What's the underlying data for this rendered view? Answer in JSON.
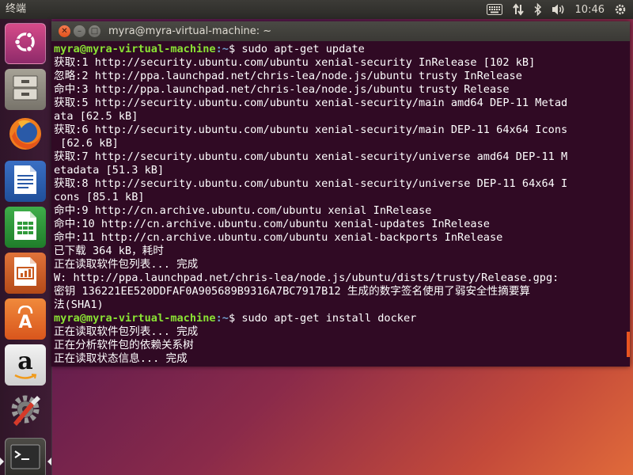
{
  "top_panel": {
    "app_title": "终端",
    "clock": "10:46"
  },
  "launcher": {
    "items": [
      {
        "name": "Dash",
        "icon": "ubuntu-dash-icon"
      },
      {
        "name": "Files",
        "icon": "files-icon"
      },
      {
        "name": "Firefox",
        "icon": "firefox-icon"
      },
      {
        "name": "LibreOffice Writer",
        "icon": "writer-icon"
      },
      {
        "name": "LibreOffice Calc",
        "icon": "calc-icon"
      },
      {
        "name": "LibreOffice Impress",
        "icon": "impress-icon"
      },
      {
        "name": "Ubuntu Software",
        "icon": "software-center-icon"
      },
      {
        "name": "Amazon",
        "icon": "amazon-icon"
      },
      {
        "name": "System Settings",
        "icon": "settings-icon"
      },
      {
        "name": "Terminal",
        "icon": "terminal-icon"
      }
    ],
    "amazon_letter": "a",
    "software_letter": "A"
  },
  "terminal": {
    "title": "myra@myra-virtual-machine: ~",
    "prompt_user": "myra@myra-virtual-machine",
    "prompt_path": ":~",
    "lines": [
      {
        "type": "prompt",
        "cmd": "$ sudo apt-get update"
      },
      {
        "type": "text",
        "text": "获取:1 http://security.ubuntu.com/ubuntu xenial-security InRelease [102 kB]"
      },
      {
        "type": "text",
        "text": "忽略:2 http://ppa.launchpad.net/chris-lea/node.js/ubuntu trusty InRelease"
      },
      {
        "type": "text",
        "text": "命中:3 http://ppa.launchpad.net/chris-lea/node.js/ubuntu trusty Release"
      },
      {
        "type": "text",
        "text": "获取:5 http://security.ubuntu.com/ubuntu xenial-security/main amd64 DEP-11 Metad"
      },
      {
        "type": "text",
        "text": "ata [62.5 kB]"
      },
      {
        "type": "text",
        "text": "获取:6 http://security.ubuntu.com/ubuntu xenial-security/main DEP-11 64x64 Icons"
      },
      {
        "type": "text",
        "text": " [62.6 kB]"
      },
      {
        "type": "text",
        "text": "获取:7 http://security.ubuntu.com/ubuntu xenial-security/universe amd64 DEP-11 M"
      },
      {
        "type": "text",
        "text": "etadata [51.3 kB]"
      },
      {
        "type": "text",
        "text": "获取:8 http://security.ubuntu.com/ubuntu xenial-security/universe DEP-11 64x64 I"
      },
      {
        "type": "text",
        "text": "cons [85.1 kB]"
      },
      {
        "type": "text",
        "text": "命中:9 http://cn.archive.ubuntu.com/ubuntu xenial InRelease"
      },
      {
        "type": "text",
        "text": "命中:10 http://cn.archive.ubuntu.com/ubuntu xenial-updates InRelease"
      },
      {
        "type": "text",
        "text": "命中:11 http://cn.archive.ubuntu.com/ubuntu xenial-backports InRelease"
      },
      {
        "type": "text",
        "text": "已下载 364 kB，耗时"
      },
      {
        "type": "text",
        "text": "正在读取软件包列表... 完成"
      },
      {
        "type": "text",
        "text": "W: http://ppa.launchpad.net/chris-lea/node.js/ubuntu/dists/trusty/Release.gpg:"
      },
      {
        "type": "text",
        "text": "密钥 136221EE520DDFAF0A905689B9316A7BC7917B12 生成的数字签名使用了弱安全性摘要算"
      },
      {
        "type": "text",
        "text": "法(SHA1)"
      },
      {
        "type": "prompt",
        "cmd": "$ sudo apt-get install docker"
      },
      {
        "type": "text",
        "text": "正在读取软件包列表... 完成"
      },
      {
        "type": "text",
        "text": "正在分析软件包的依赖关系树"
      },
      {
        "type": "text",
        "text": "正在读取状态信息... 完成"
      }
    ]
  },
  "colors": {
    "terminal_bg": "#300a24",
    "prompt_user": "#8ae234",
    "prompt_path": "#729fcf",
    "accent": "#e95420"
  }
}
